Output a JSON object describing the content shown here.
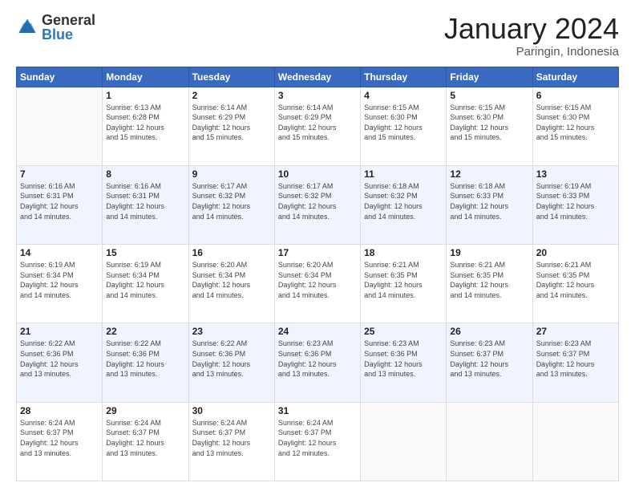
{
  "header": {
    "logo": {
      "general": "General",
      "blue": "Blue"
    },
    "title": "January 2024",
    "location": "Paringin, Indonesia"
  },
  "weekdays": [
    "Sunday",
    "Monday",
    "Tuesday",
    "Wednesday",
    "Thursday",
    "Friday",
    "Saturday"
  ],
  "weeks": [
    [
      {
        "day": "",
        "info": ""
      },
      {
        "day": "1",
        "info": "Sunrise: 6:13 AM\nSunset: 6:28 PM\nDaylight: 12 hours\nand 15 minutes."
      },
      {
        "day": "2",
        "info": "Sunrise: 6:14 AM\nSunset: 6:29 PM\nDaylight: 12 hours\nand 15 minutes."
      },
      {
        "day": "3",
        "info": "Sunrise: 6:14 AM\nSunset: 6:29 PM\nDaylight: 12 hours\nand 15 minutes."
      },
      {
        "day": "4",
        "info": "Sunrise: 6:15 AM\nSunset: 6:30 PM\nDaylight: 12 hours\nand 15 minutes."
      },
      {
        "day": "5",
        "info": "Sunrise: 6:15 AM\nSunset: 6:30 PM\nDaylight: 12 hours\nand 15 minutes."
      },
      {
        "day": "6",
        "info": "Sunrise: 6:15 AM\nSunset: 6:30 PM\nDaylight: 12 hours\nand 15 minutes."
      }
    ],
    [
      {
        "day": "7",
        "info": "Sunrise: 6:16 AM\nSunset: 6:31 PM\nDaylight: 12 hours\nand 14 minutes."
      },
      {
        "day": "8",
        "info": "Sunrise: 6:16 AM\nSunset: 6:31 PM\nDaylight: 12 hours\nand 14 minutes."
      },
      {
        "day": "9",
        "info": "Sunrise: 6:17 AM\nSunset: 6:32 PM\nDaylight: 12 hours\nand 14 minutes."
      },
      {
        "day": "10",
        "info": "Sunrise: 6:17 AM\nSunset: 6:32 PM\nDaylight: 12 hours\nand 14 minutes."
      },
      {
        "day": "11",
        "info": "Sunrise: 6:18 AM\nSunset: 6:32 PM\nDaylight: 12 hours\nand 14 minutes."
      },
      {
        "day": "12",
        "info": "Sunrise: 6:18 AM\nSunset: 6:33 PM\nDaylight: 12 hours\nand 14 minutes."
      },
      {
        "day": "13",
        "info": "Sunrise: 6:19 AM\nSunset: 6:33 PM\nDaylight: 12 hours\nand 14 minutes."
      }
    ],
    [
      {
        "day": "14",
        "info": "Sunrise: 6:19 AM\nSunset: 6:34 PM\nDaylight: 12 hours\nand 14 minutes."
      },
      {
        "day": "15",
        "info": "Sunrise: 6:19 AM\nSunset: 6:34 PM\nDaylight: 12 hours\nand 14 minutes."
      },
      {
        "day": "16",
        "info": "Sunrise: 6:20 AM\nSunset: 6:34 PM\nDaylight: 12 hours\nand 14 minutes."
      },
      {
        "day": "17",
        "info": "Sunrise: 6:20 AM\nSunset: 6:34 PM\nDaylight: 12 hours\nand 14 minutes."
      },
      {
        "day": "18",
        "info": "Sunrise: 6:21 AM\nSunset: 6:35 PM\nDaylight: 12 hours\nand 14 minutes."
      },
      {
        "day": "19",
        "info": "Sunrise: 6:21 AM\nSunset: 6:35 PM\nDaylight: 12 hours\nand 14 minutes."
      },
      {
        "day": "20",
        "info": "Sunrise: 6:21 AM\nSunset: 6:35 PM\nDaylight: 12 hours\nand 14 minutes."
      }
    ],
    [
      {
        "day": "21",
        "info": "Sunrise: 6:22 AM\nSunset: 6:36 PM\nDaylight: 12 hours\nand 13 minutes."
      },
      {
        "day": "22",
        "info": "Sunrise: 6:22 AM\nSunset: 6:36 PM\nDaylight: 12 hours\nand 13 minutes."
      },
      {
        "day": "23",
        "info": "Sunrise: 6:22 AM\nSunset: 6:36 PM\nDaylight: 12 hours\nand 13 minutes."
      },
      {
        "day": "24",
        "info": "Sunrise: 6:23 AM\nSunset: 6:36 PM\nDaylight: 12 hours\nand 13 minutes."
      },
      {
        "day": "25",
        "info": "Sunrise: 6:23 AM\nSunset: 6:36 PM\nDaylight: 12 hours\nand 13 minutes."
      },
      {
        "day": "26",
        "info": "Sunrise: 6:23 AM\nSunset: 6:37 PM\nDaylight: 12 hours\nand 13 minutes."
      },
      {
        "day": "27",
        "info": "Sunrise: 6:23 AM\nSunset: 6:37 PM\nDaylight: 12 hours\nand 13 minutes."
      }
    ],
    [
      {
        "day": "28",
        "info": "Sunrise: 6:24 AM\nSunset: 6:37 PM\nDaylight: 12 hours\nand 13 minutes."
      },
      {
        "day": "29",
        "info": "Sunrise: 6:24 AM\nSunset: 6:37 PM\nDaylight: 12 hours\nand 13 minutes."
      },
      {
        "day": "30",
        "info": "Sunrise: 6:24 AM\nSunset: 6:37 PM\nDaylight: 12 hours\nand 13 minutes."
      },
      {
        "day": "31",
        "info": "Sunrise: 6:24 AM\nSunset: 6:37 PM\nDaylight: 12 hours\nand 12 minutes."
      },
      {
        "day": "",
        "info": ""
      },
      {
        "day": "",
        "info": ""
      },
      {
        "day": "",
        "info": ""
      }
    ]
  ]
}
